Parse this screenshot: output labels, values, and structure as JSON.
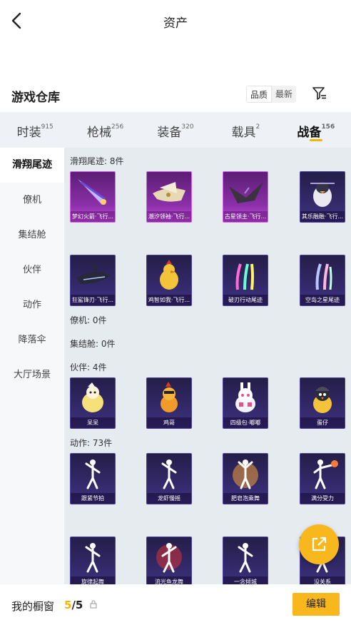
{
  "header": {
    "title": "资产"
  },
  "warehouse": {
    "title": "游戏仓库",
    "sort_quality": "品质",
    "sort_latest": "最新"
  },
  "tabs": [
    {
      "label": "时装",
      "count": "915",
      "active": false
    },
    {
      "label": "枪械",
      "count": "256",
      "active": false
    },
    {
      "label": "装备",
      "count": "320",
      "active": false
    },
    {
      "label": "载具",
      "count": "2",
      "active": false
    },
    {
      "label": "战备",
      "count": "156",
      "active": true
    }
  ],
  "sidebar": {
    "items": [
      {
        "label": "滑翔尾迹",
        "active": true
      },
      {
        "label": "僚机",
        "active": false
      },
      {
        "label": "集结舱",
        "active": false
      },
      {
        "label": "伙伴",
        "active": false
      },
      {
        "label": "动作",
        "active": false
      },
      {
        "label": "降落伞",
        "active": false
      },
      {
        "label": "大厅场景",
        "active": false
      }
    ]
  },
  "content": {
    "sections": [
      {
        "label": "滑翔尾迹: 8件"
      },
      {
        "label": "僚机: 0件"
      },
      {
        "label": "集结舱: 0件"
      },
      {
        "label": "伙伴: 4件"
      },
      {
        "label": "动作: 73件"
      }
    ],
    "glide": [
      {
        "name": "梦幻火箭·飞行...",
        "icon": "rocket",
        "rarity": "pink"
      },
      {
        "name": "潮汐领袖·飞行...",
        "icon": "ship",
        "rarity": "pink"
      },
      {
        "name": "古星领主·飞行...",
        "icon": "dark-wing",
        "rarity": "pink"
      },
      {
        "name": "其乐融融·飞行...",
        "icon": "penguin",
        "rarity": "purple"
      },
      {
        "name": "狂鲨锋刃·飞行...",
        "icon": "shark",
        "rarity": "purple"
      },
      {
        "name": "鸡智如我·飞行...",
        "icon": "chicken",
        "rarity": "purple"
      },
      {
        "name": "破刃行动尾迹",
        "icon": "trail-rainbow",
        "rarity": "purple"
      },
      {
        "name": "空岛之星尾迹",
        "icon": "trail-pastel",
        "rarity": "purple"
      }
    ],
    "partners": [
      {
        "name": "呆呆",
        "icon": "chick",
        "rarity": "purple"
      },
      {
        "name": "鸡哥",
        "icon": "rooster",
        "rarity": "purple"
      },
      {
        "name": "四级包·嘟嘟",
        "icon": "bunny-robot",
        "rarity": "purple"
      },
      {
        "name": "蛋仔",
        "icon": "penguin-helmet",
        "rarity": "purple"
      }
    ],
    "emotes": [
      {
        "name": "跟紧节拍",
        "icon": "dancer",
        "rarity": "purple"
      },
      {
        "name": "龙虾慢摇",
        "icon": "dancer",
        "rarity": "purple"
      },
      {
        "name": "肥皂泡乘舞",
        "icon": "dancer-gold",
        "rarity": "purple"
      },
      {
        "name": "满分受力",
        "icon": "dancer-flame",
        "rarity": "purple"
      },
      {
        "name": "旋律起舞",
        "icon": "dancer",
        "rarity": "purple"
      },
      {
        "name": "流光鱼龙舞",
        "icon": "dancer-red",
        "rarity": "purple"
      },
      {
        "name": "一念倾城",
        "icon": "dancer",
        "rarity": "purple"
      },
      {
        "name": "没关系",
        "icon": "dancer",
        "rarity": "purple"
      }
    ]
  },
  "footer": {
    "label": "我的橱窗",
    "count_current": "5",
    "count_total": "/5",
    "edit_label": "编辑"
  },
  "colors": {
    "accent": "#f8b71c",
    "tab_bg": "#eef2f6",
    "content_bg": "#e6ebf0"
  }
}
